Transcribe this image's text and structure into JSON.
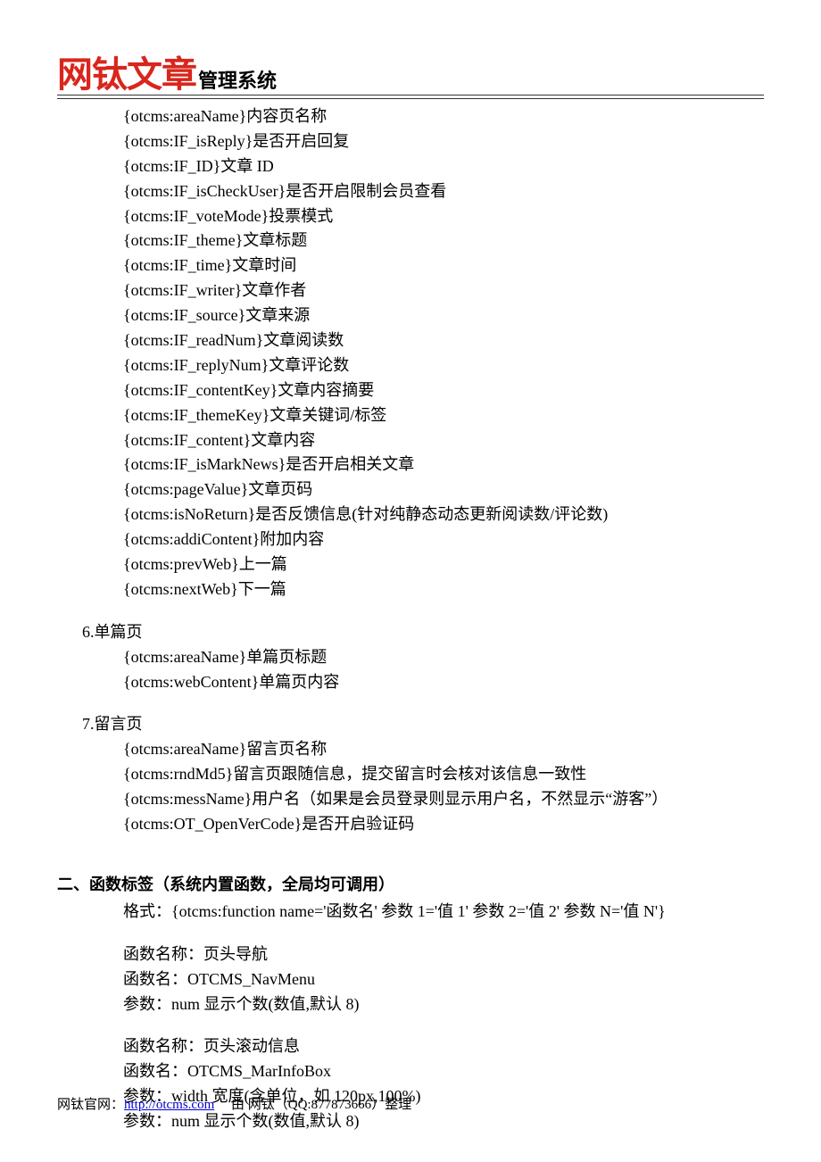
{
  "logo": {
    "main": "网钛文章",
    "sub": "管理系统"
  },
  "section5_lines": [
    "{otcms:areaName}内容页名称",
    "{otcms:IF_isReply}是否开启回复",
    "{otcms:IF_ID}文章 ID",
    "{otcms:IF_isCheckUser}是否开启限制会员查看",
    "{otcms:IF_voteMode}投票模式",
    "{otcms:IF_theme}文章标题",
    "{otcms:IF_time}文章时间",
    "{otcms:IF_writer}文章作者",
    "{otcms:IF_source}文章来源",
    "{otcms:IF_readNum}文章阅读数",
    "{otcms:IF_replyNum}文章评论数",
    "{otcms:IF_contentKey}文章内容摘要",
    "{otcms:IF_themeKey}文章关键词/标签",
    "{otcms:IF_content}文章内容",
    "{otcms:IF_isMarkNews}是否开启相关文章",
    "{otcms:pageValue}文章页码",
    "{otcms:isNoReturn}是否反馈信息(针对纯静态动态更新阅读数/评论数)",
    "{otcms:addiContent}附加内容",
    "{otcms:prevWeb}上一篇",
    "{otcms:nextWeb}下一篇"
  ],
  "section6_title": "6.单篇页",
  "section6_lines": [
    "{otcms:areaName}单篇页标题",
    "{otcms:webContent}单篇页内容"
  ],
  "section7_title": "7.留言页",
  "section7_lines": [
    "{otcms:areaName}留言页名称",
    "{otcms:rndMd5}留言页跟随信息，提交留言时会核对该信息一致性",
    "{otcms:messName}用户名（如果是会员登录则显示用户名，不然显示“游客”）",
    "{otcms:OT_OpenVerCode}是否开启验证码"
  ],
  "h2": "二、函数标签（系统内置函数，全局均可调用）",
  "format_line": "格式：{otcms:function name='函数名'  参数 1='值 1'  参数 2='值 2'  参数 N='值 N'}",
  "func1": [
    "函数名称：页头导航",
    "函数名：OTCMS_NavMenu",
    "参数：num  显示个数(数值,默认 8)"
  ],
  "func2": [
    "函数名称：页头滚动信息",
    "函数名：OTCMS_MarInfoBox",
    "参数：width  宽度(含单位，如 120px,100%)",
    "参数：num  显示个数(数值,默认 8)"
  ],
  "footer": {
    "prefix": "网钛官网：",
    "url": "http://otcms.com",
    "suffix": "由  网钛（QQ:877873666）整理"
  }
}
